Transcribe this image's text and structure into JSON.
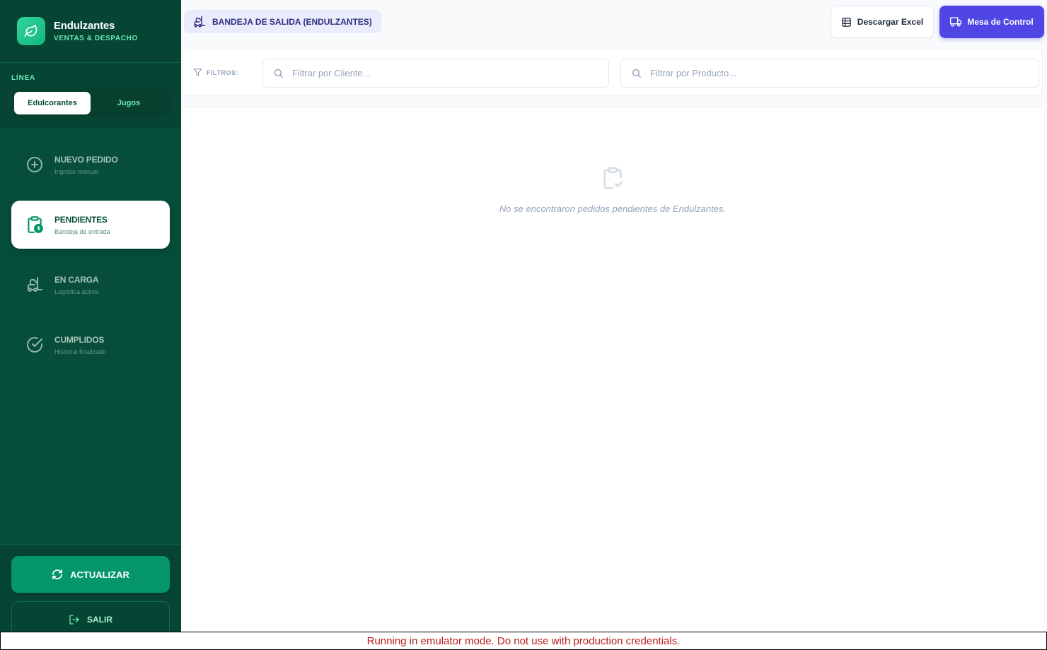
{
  "brand": {
    "name": "Endulzantes",
    "subtitle": "VENTAS & DESPACHO"
  },
  "linea": {
    "label": "LÍNEA",
    "options": [
      {
        "label": "Edulcorantes",
        "active": true
      },
      {
        "label": "Jugos",
        "active": false
      }
    ]
  },
  "nav": [
    {
      "title": "NUEVO PEDIDO",
      "subtitle": "Ingreso manual",
      "icon": "plus-circle-icon",
      "active": false
    },
    {
      "title": "PENDIENTES",
      "subtitle": "Bandeja de entrada",
      "icon": "clipboard-clock-icon",
      "active": true
    },
    {
      "title": "EN CARGA",
      "subtitle": "Logística activa",
      "icon": "forklift-icon",
      "active": false
    },
    {
      "title": "CUMPLIDOS",
      "subtitle": "Historial finalizado",
      "icon": "check-circle-icon",
      "active": false
    }
  ],
  "sidebar_actions": {
    "refresh": "ACTUALIZAR",
    "logout": "SALIR"
  },
  "header": {
    "breadcrumb": "BANDEJA DE SALIDA (ENDULZANTES)",
    "excel_button": "Descargar Excel",
    "control_button": "Mesa de Control"
  },
  "filters": {
    "label": "FILTROS:",
    "client_placeholder": "Filtrar por Cliente...",
    "product_placeholder": "Filtrar por Producto..."
  },
  "empty_state": {
    "message": "No se encontraron pedidos pendientes de Endulzantes."
  },
  "banner": {
    "text": "Running in emulator mode. Do not use with production credentials."
  },
  "colors": {
    "sidebar": "#064e3b",
    "accent_green": "#059669",
    "accent_indigo": "#4f46e5",
    "banner_text": "#b91c1c"
  }
}
